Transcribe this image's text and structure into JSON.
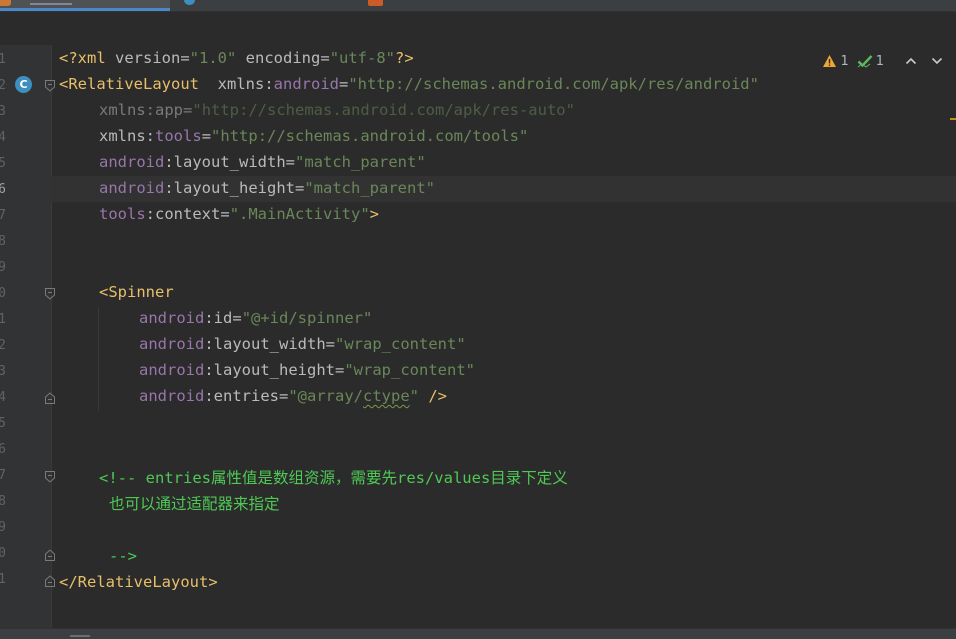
{
  "editor": {
    "line_numbers": [
      "1",
      "2",
      "3",
      "4",
      "5",
      "6",
      "7",
      "8",
      "9",
      "0",
      "1",
      "2",
      "3",
      "4",
      "5",
      "6",
      "7",
      "8",
      "9",
      "0",
      "1"
    ],
    "current_line_index": 5,
    "lines": {
      "l1": {
        "open": "<?",
        "name": "xml",
        "attr1": " version",
        "eq1": "=",
        "val1": "\"1.0\"",
        "attr2": " encoding",
        "eq2": "=",
        "val2": "\"utf-8\"",
        "close": "?>"
      },
      "l2": {
        "open": "<RelativeLayout",
        "space": "  ",
        "ns": "xmlns",
        "colon": ":",
        "attr": "android",
        "eq": "=",
        "val": "\"http://schemas.android.com/apk/res/android\""
      },
      "l3": {
        "ns": "xmlns",
        "colon": ":",
        "attr": "app",
        "eq": "=",
        "val": "\"http://schemas.android.com/apk/res-auto\""
      },
      "l4": {
        "ns": "xmlns",
        "colon": ":",
        "attr": "tools",
        "eq": "=",
        "val": "\"http://schemas.android.com/tools\""
      },
      "l5": {
        "ns": "android",
        "colon": ":",
        "attr": "layout_width",
        "eq": "=",
        "val": "\"match_parent\""
      },
      "l6": {
        "ns": "android",
        "colon": ":",
        "attr": "layout_height",
        "eq": "=",
        "val": "\"match_parent\""
      },
      "l7": {
        "ns": "tools",
        "colon": ":",
        "attr": "context",
        "eq": "=",
        "val": "\".MainActivity\"",
        "close": ">"
      },
      "l10": {
        "open": "<Spinner"
      },
      "l11": {
        "ns": "android",
        "colon": ":",
        "attr": "id",
        "eq": "=",
        "val": "\"@+id/spinner\""
      },
      "l12": {
        "ns": "android",
        "colon": ":",
        "attr": "layout_width",
        "eq": "=",
        "val": "\"wrap_content\""
      },
      "l13": {
        "ns": "android",
        "colon": ":",
        "attr": "layout_height",
        "eq": "=",
        "val": "\"wrap_content\""
      },
      "l14": {
        "ns": "android",
        "colon": ":",
        "attr": "entries",
        "eq": "=",
        "val_a": "\"@array/",
        "val_b": "ctype",
        "val_c": "\"",
        "close": " />"
      },
      "l17": {
        "text": "<!-- entries属性值是数组资源，需要先res/values目录下定义"
      },
      "l18": {
        "text": "也可以通过适配器来指定"
      },
      "l20": {
        "text": "-->"
      },
      "l21": {
        "open": "</RelativeLayout",
        "close": ">"
      }
    }
  },
  "inspections": {
    "warning_count": "1",
    "ok_count": "1",
    "warning_icon": "warning-triangle-icon",
    "ok_icon": "checkmark-icon",
    "prev_icon": "chevron-up-icon",
    "next_icon": "chevron-down-icon"
  },
  "gutter": {
    "class_icon": "class-c-icon",
    "class_icon_letter": "C"
  },
  "colors": {
    "background": "#2b2b2b",
    "tag": "#e8bf6a",
    "namespace": "#9876aa",
    "attribute": "#bababa",
    "value": "#6a8759",
    "comment": "#4ec955",
    "warning": "#f0a732",
    "ok": "#5fb85f"
  }
}
